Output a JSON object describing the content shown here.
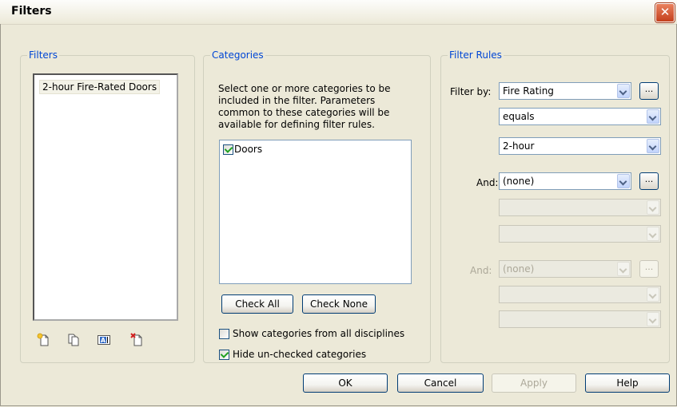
{
  "window": {
    "title": "Filters",
    "close_glyph": "✕"
  },
  "filters_group": {
    "legend": "Filters",
    "items": [
      "2-hour Fire-Rated Doors"
    ],
    "toolbar_icons": [
      "new-filter-icon",
      "duplicate-filter-icon",
      "rename-filter-icon",
      "delete-filter-icon"
    ],
    "rename_glyph": "A"
  },
  "categories_group": {
    "legend": "Categories",
    "description": "Select one or more categories to be included in the filter.  Parameters common to these categories will be available for defining filter rules.",
    "items": [
      {
        "label": "Doors",
        "checked": true
      }
    ],
    "check_all": "Check All",
    "check_none": "Check None",
    "show_all_disciplines": {
      "label": "Show categories from all disciplines",
      "checked": false
    },
    "hide_unchecked": {
      "label": "Hide un-checked categories",
      "checked": true
    }
  },
  "filter_rules": {
    "legend": "Filter Rules",
    "filter_by_label": "Filter by:",
    "rule1": {
      "parameter": "Fire Rating",
      "operator": "equals",
      "value": "2-hour"
    },
    "and1_label": "And:",
    "rule2": {
      "parameter": "(none)",
      "operator": "",
      "value": ""
    },
    "and2_label": "And:",
    "rule3": {
      "parameter": "(none)",
      "operator": "",
      "value": ""
    },
    "ellipsis": "..."
  },
  "buttons": {
    "ok": "OK",
    "cancel": "Cancel",
    "apply": "Apply",
    "help": "Help"
  },
  "colors": {
    "legend": "#0046d5",
    "dialog_bg": "#ece9d8",
    "close_red": "#d6532d"
  }
}
